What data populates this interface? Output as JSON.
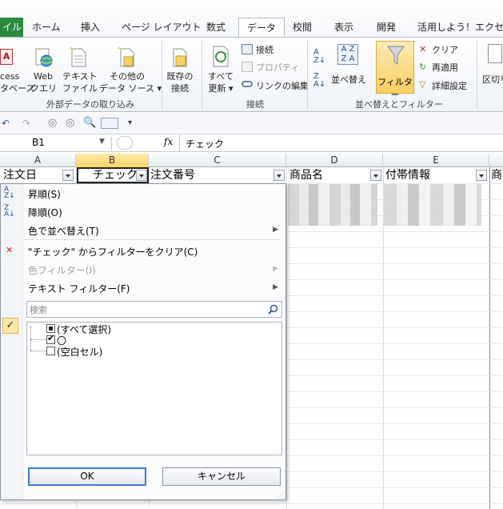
{
  "ribbon_tabs": {
    "file": "イル",
    "home": "ホーム",
    "insert": "挿入",
    "page_layout": "ページ レイアウト",
    "formulas": "数式",
    "data": "データ",
    "review": "校閲",
    "view": "表示",
    "developer": "開発",
    "addin": "活用しよう！エクセル"
  },
  "ribbon": {
    "access_1": "cess",
    "access_2": "タベース",
    "web_1": "Web",
    "web_2": "クエリ",
    "text_1": "テキスト",
    "text_2": "ファイル",
    "other_1": "その他の",
    "other_2": "データ ソース ▾",
    "existing_1": "既存の",
    "existing_2": "接続",
    "group_external": "外部データの取り込み",
    "refresh_1": "すべて",
    "refresh_2": "更新 ▾",
    "connections": "接続",
    "properties": "プロパティ",
    "edit_links": "リンクの編集",
    "group_connections": "接続",
    "sort": "並べ替え",
    "filter": "フィルター",
    "clear": "クリア",
    "reapply": "再適用",
    "advanced": "詳細設定",
    "group_sortfilter": "並べ替えとフィルター",
    "text_to_columns": "区切り"
  },
  "formula_bar": {
    "name_box": "B1",
    "fx": "fx",
    "content": "チェック"
  },
  "columns": {
    "a": "A",
    "b": "B",
    "c": "C",
    "d": "D",
    "e": "E"
  },
  "header_row": {
    "a": "注文日",
    "b": "チェック",
    "c": "注文番号",
    "d": "商品名",
    "e": "付帯情報",
    "f": "商"
  },
  "menu": {
    "sort_asc": "昇順(S)",
    "sort_desc": "降順(O)",
    "sort_by_color": "色で並べ替え(T)",
    "clear_filter": "\"チェック\" からフィルターをクリア(C)",
    "color_filter": "色フィルター(I)",
    "text_filter": "テキスト フィルター(F)",
    "search_placeholder": "検索",
    "items": [
      "(すべて選択)",
      "〇",
      "(空白セル)"
    ],
    "ok": "OK",
    "cancel": "キャンセル"
  },
  "colors": {
    "accent": "#3a7bd5",
    "file_tab": "#2a8a3e",
    "selected_col": "#f8d46a"
  }
}
